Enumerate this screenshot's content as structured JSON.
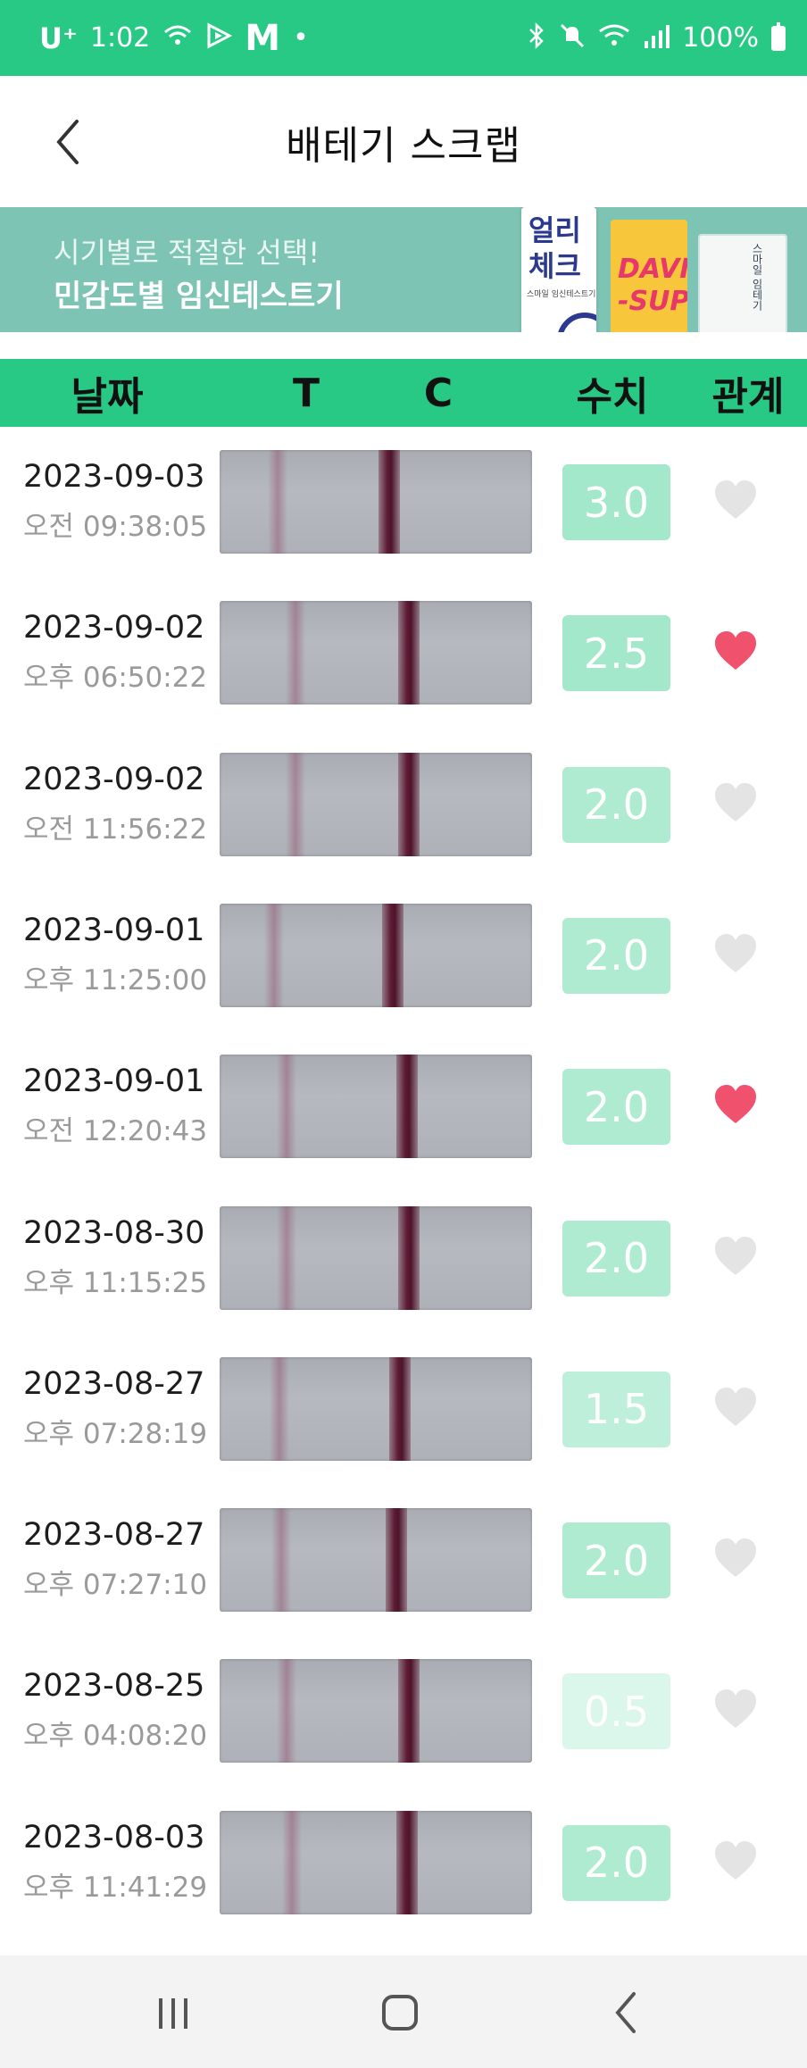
{
  "status_bar": {
    "carrier": "U⁺",
    "time": "1:02",
    "battery": "100%",
    "icons_left": [
      "wifi-calling-icon",
      "play-icon",
      "m-icon",
      "dot-icon"
    ],
    "icons_right": [
      "bluetooth-icon",
      "mute-icon",
      "wifi-icon",
      "signal-icon",
      "battery-icon"
    ]
  },
  "header": {
    "title": "배테기 스크랩",
    "back_icon": "chevron-left-icon"
  },
  "banner": {
    "subtitle": "시기별로 적절한 선택!",
    "title": "민감도별 임신테스트기",
    "pkg1_label": "얼리\n체크",
    "pkg1_small": "스마일 임신테스트기",
    "pkg2_label": "DAVI\n-SUPE",
    "pkg3_label": "스마일 임테기"
  },
  "table_header": {
    "date": "날짜",
    "t": "T",
    "c": "C",
    "value": "수치",
    "relation": "관계"
  },
  "colors": {
    "accent": "#27c984",
    "heart_on": "#f0516d",
    "heart_off": "#e4e4e4"
  },
  "rows": [
    {
      "date": "2023-09-03",
      "time": "오전 09:38:05",
      "value": "3.0",
      "liked": false
    },
    {
      "date": "2023-09-02",
      "time": "오후 06:50:22",
      "value": "2.5",
      "liked": true
    },
    {
      "date": "2023-09-02",
      "time": "오전 11:56:22",
      "value": "2.0",
      "liked": false
    },
    {
      "date": "2023-09-01",
      "time": "오후 11:25:00",
      "value": "2.0",
      "liked": false
    },
    {
      "date": "2023-09-01",
      "time": "오전 12:20:43",
      "value": "2.0",
      "liked": true
    },
    {
      "date": "2023-08-30",
      "time": "오후 11:15:25",
      "value": "2.0",
      "liked": false
    },
    {
      "date": "2023-08-27",
      "time": "오후 07:28:19",
      "value": "1.5",
      "liked": false
    },
    {
      "date": "2023-08-27",
      "time": "오후 07:27:10",
      "value": "2.0",
      "liked": false
    },
    {
      "date": "2023-08-25",
      "time": "오후 04:08:20",
      "value": "0.5",
      "liked": false
    },
    {
      "date": "2023-08-03",
      "time": "오후 11:41:29",
      "value": "2.0",
      "liked": false
    }
  ],
  "nav": {
    "recents_icon": "recents-icon",
    "home_icon": "home-icon",
    "back_icon": "back-icon"
  }
}
